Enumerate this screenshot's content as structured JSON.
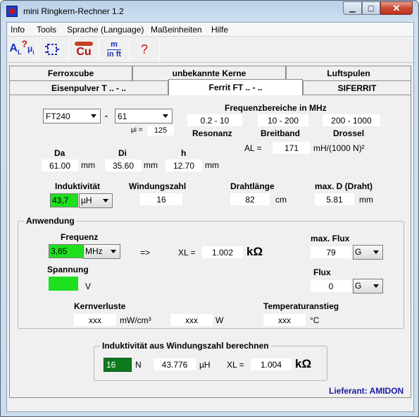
{
  "window": {
    "title": "mini Ringkern-Rechner 1.2",
    "close_glyph": "✕",
    "min_glyph": "▁",
    "max_glyph": "▢"
  },
  "menu": [
    "Info",
    "Tools",
    "Sprache (Language)",
    "Maßeinheiten",
    "Hilfe"
  ],
  "toolbar": {
    "al_label": "A",
    "al_sub": "L",
    "mu_label": "μ",
    "mu_sub": "i",
    "cu_label": "Cu",
    "unit_top": "m",
    "unit_bottom": "in ft",
    "help_label": "?"
  },
  "tabs": {
    "row1": [
      "Ferroxcube",
      "unbekannte Kerne",
      "Luftspulen"
    ],
    "row2": [
      "Eisenpulver T .. - ..",
      "Ferrit FT .. - ..",
      "SIFERRIT"
    ],
    "active": "Ferrit FT .. - .."
  },
  "core": {
    "type": "FT240",
    "dash": "-",
    "material": "61",
    "mu_label": "μi =",
    "mu_value": "125"
  },
  "freq": {
    "title": "Frequenzbereiche in MHz",
    "resonanz_value": "0.2 - 10",
    "resonanz_label": "Resonanz",
    "breitband_value": "10 - 200",
    "breitband_label": "Breitband",
    "drossel_value": "200 - 1000",
    "drossel_label": "Drossel"
  },
  "al": {
    "label": "AL =",
    "value": "171",
    "unit": "mH/(1000 N)²"
  },
  "dims": {
    "da_label": "Da",
    "da_value": "61.00",
    "da_unit": "mm",
    "di_label": "Di",
    "di_value": "35.60",
    "di_unit": "mm",
    "h_label": "h",
    "h_value": "12.70",
    "h_unit": "mm"
  },
  "coil": {
    "ind_label": "Induktivität",
    "ind_value": "43,7",
    "ind_unit": "µH",
    "turns_label": "Windungszahl",
    "turns_value": "16",
    "wire_label": "Drahtlänge",
    "wire_value": "82",
    "wire_unit": "cm",
    "maxd_label": "max. D (Draht)",
    "maxd_value": "5.81",
    "maxd_unit": "mm"
  },
  "anwendung": {
    "title": "Anwendung",
    "freq_label": "Frequenz",
    "freq_value": "3,65",
    "freq_unit": "MHz",
    "arrow": "=>",
    "xl_label": "XL =",
    "xl_value": "1.002",
    "xl_unit": "kΩ",
    "volt_label": "Spannung",
    "volt_value": "",
    "volt_unit": "V",
    "maxflux_label": "max. Flux",
    "maxflux_value": "79",
    "maxflux_unit": "G",
    "flux_label": "Flux",
    "flux_value": "0",
    "flux_unit": "G",
    "kv_label": "Kernverluste",
    "kv_value": "xxx",
    "kv_unit": "mW/cm³",
    "w_value": "xxx",
    "w_unit": "W",
    "temp_label": "Temperaturanstieg",
    "temp_value": "xxx",
    "temp_unit": "°C"
  },
  "calc": {
    "title": "Induktivität aus Windungszahl berechnen",
    "n_value": "16",
    "n_label": "N",
    "ind_value": "43.776",
    "ind_unit": "µH",
    "xl_label": "XL =",
    "xl_value": "1.004",
    "xl_unit": "kΩ"
  },
  "supplier": "Lieferant: AMIDON",
  "colors": {
    "accent_green": "#1ee01e",
    "dark_green": "#0e7a1e",
    "supplier_blue": "#1a1aa0"
  }
}
